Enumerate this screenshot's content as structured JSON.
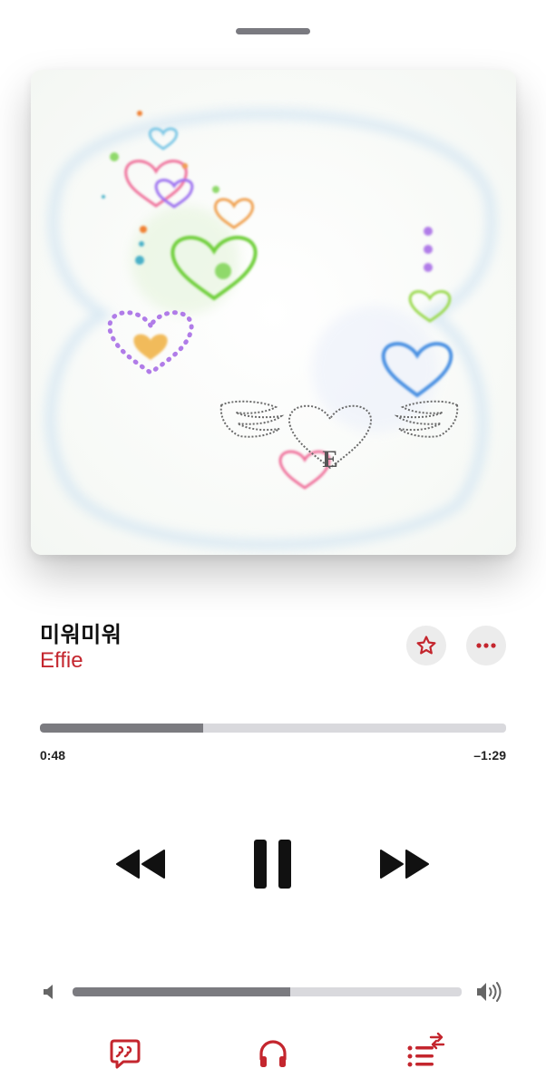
{
  "track": {
    "title": "미워미워",
    "artist": "Effie"
  },
  "artwork": {
    "description_icon": "album-art-hearts-wings",
    "monogram": "E"
  },
  "playback": {
    "elapsed": "0:48",
    "remaining": "–1:29",
    "progress_fraction": 0.35
  },
  "volume": {
    "level_fraction": 0.56
  },
  "controls": {
    "rewind_icon": "backward-icon",
    "play_pause_icon": "pause-icon",
    "forward_icon": "forward-icon",
    "favorite_icon": "star-icon",
    "more_icon": "ellipsis-icon",
    "lyrics_icon": "lyrics-quote-icon",
    "airplay_icon": "headphones-icon",
    "queue_icon": "queue-list-icon"
  },
  "colors": {
    "accent": "#c4262e",
    "track_fill": "#7b7b80",
    "track_bg": "#d9d9dd"
  }
}
